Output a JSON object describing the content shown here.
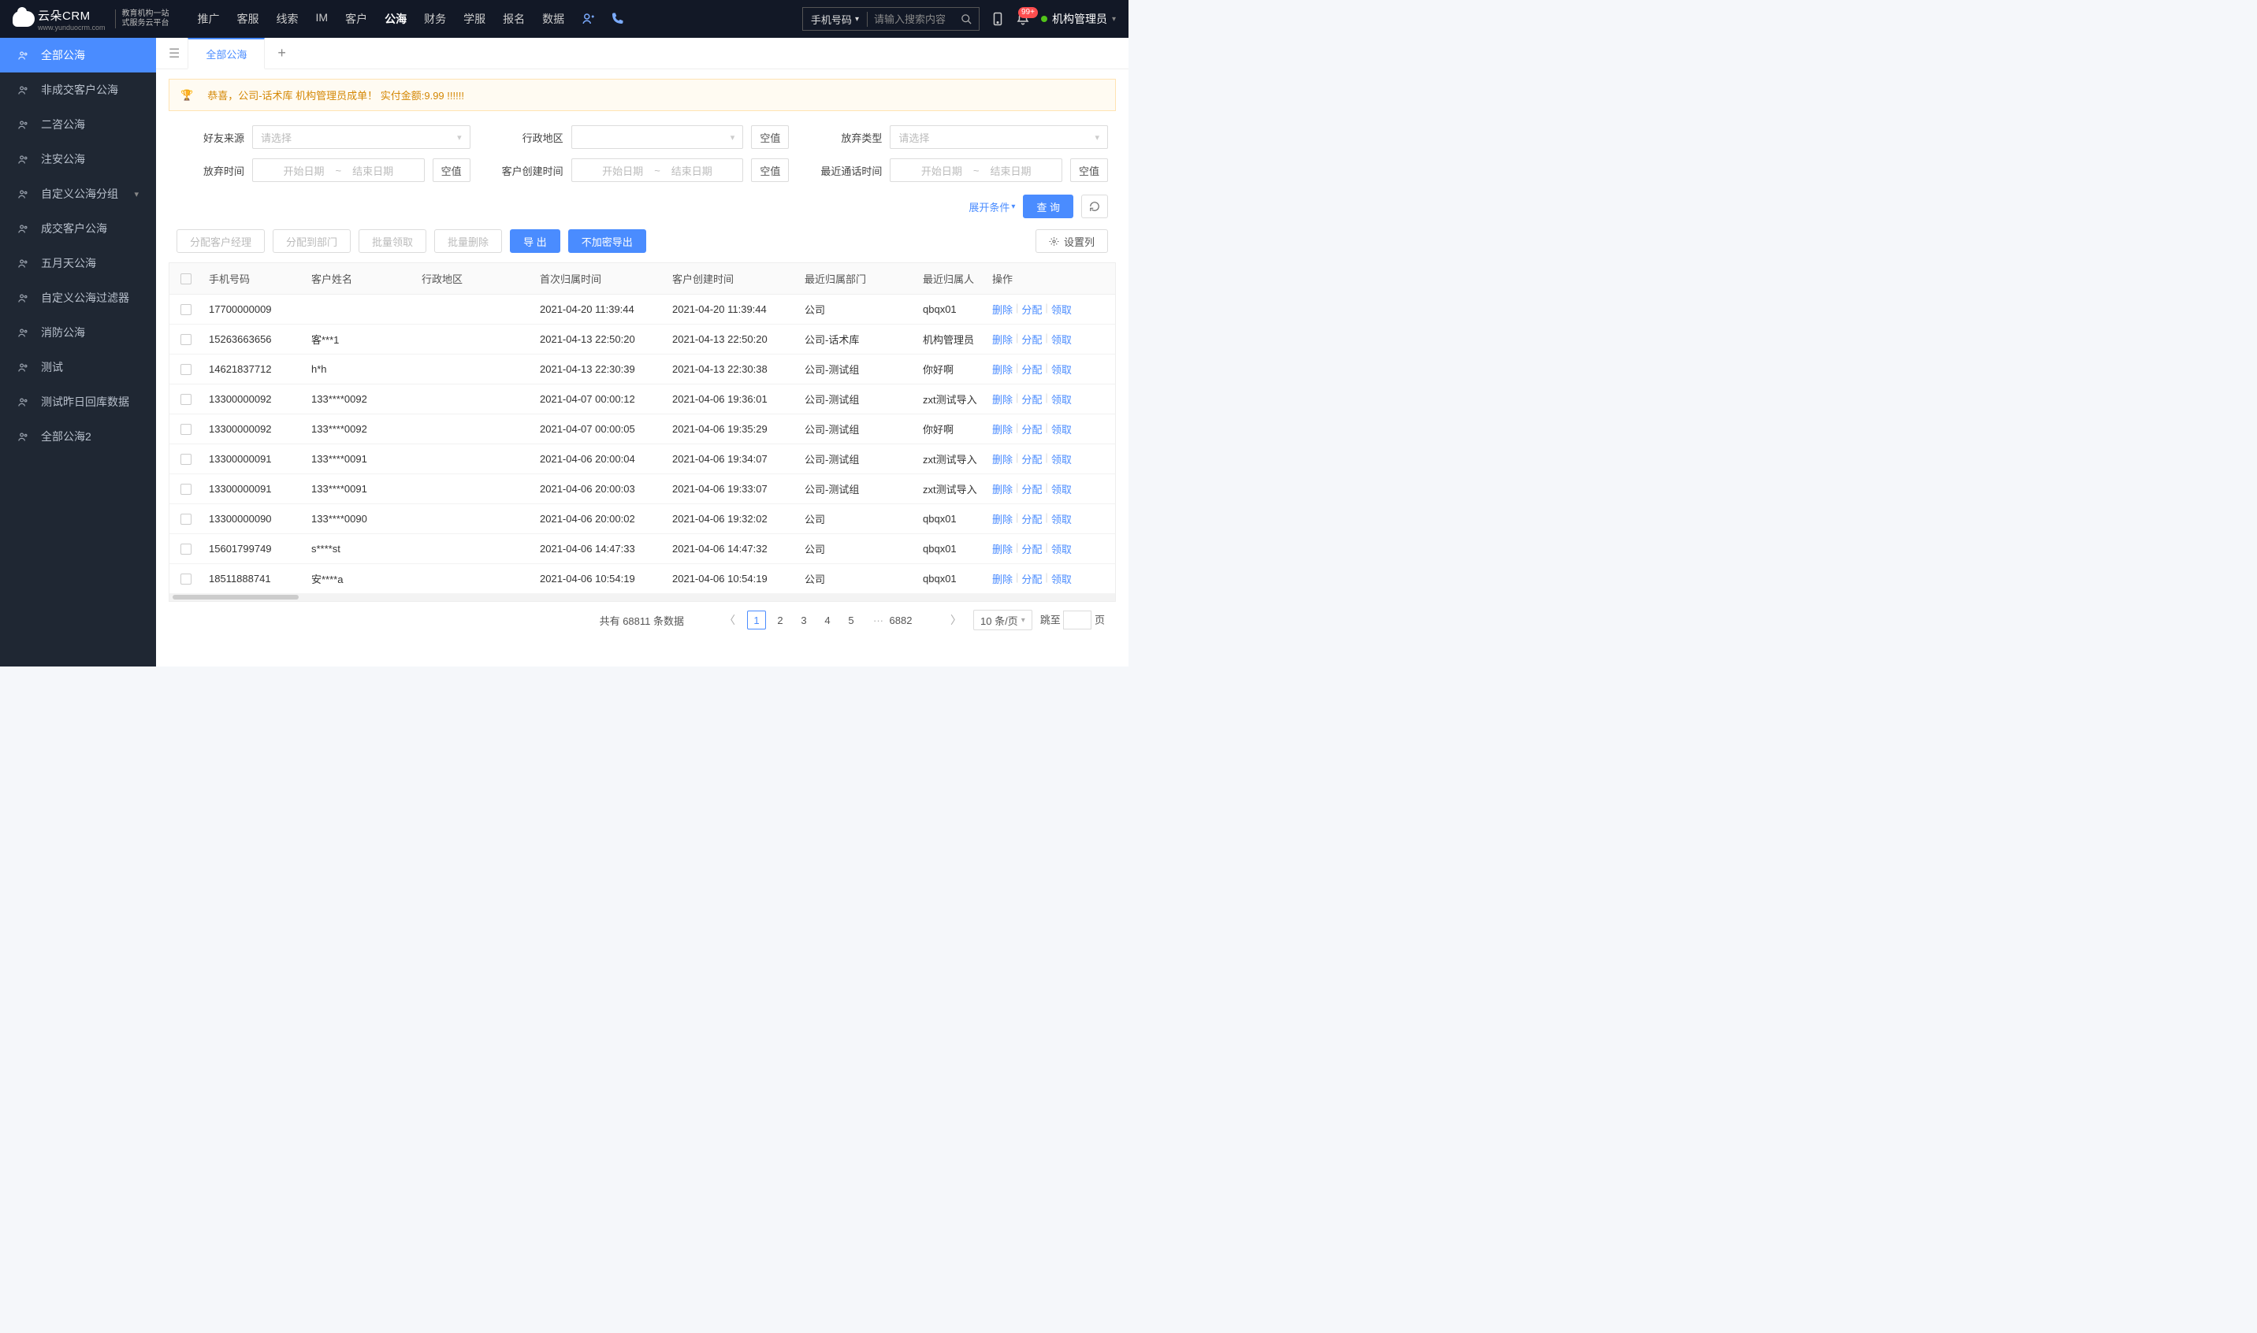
{
  "brand": {
    "name": "云朵CRM",
    "sub1": "教育机构一站",
    "sub2": "式服务云平台",
    "site": "www.yunduocrm.com"
  },
  "top_nav": {
    "items": [
      "推广",
      "客服",
      "线索",
      "IM",
      "客户",
      "公海",
      "财务",
      "学服",
      "报名",
      "数据"
    ],
    "active_index": 5
  },
  "top_search": {
    "type_label": "手机号码",
    "placeholder": "请输入搜索内容"
  },
  "notif_badge": "99+",
  "user_name": "机构管理员",
  "sidebar": {
    "items": [
      {
        "label": "全部公海",
        "active": true
      },
      {
        "label": "非成交客户公海"
      },
      {
        "label": "二咨公海"
      },
      {
        "label": "注安公海"
      },
      {
        "label": "自定义公海分组",
        "chevron": true
      },
      {
        "label": "成交客户公海"
      },
      {
        "label": "五月天公海"
      },
      {
        "label": "自定义公海过滤器"
      },
      {
        "label": "消防公海"
      },
      {
        "label": "测试"
      },
      {
        "label": "测试昨日回库数据"
      },
      {
        "label": "全部公海2"
      }
    ]
  },
  "tabs": {
    "active": "全部公海"
  },
  "banner": "恭喜，公司-话术库  机构管理员成单！  实付金额:9.99 !!!!!!",
  "filters": {
    "source": {
      "label": "好友来源",
      "placeholder": "请选择"
    },
    "area": {
      "label": "行政地区",
      "empty": "空值"
    },
    "abandon_type": {
      "label": "放弃类型",
      "placeholder": "请选择"
    },
    "abandon_time": {
      "label": "放弃时间",
      "start": "开始日期",
      "end": "结束日期",
      "empty": "空值"
    },
    "create_time": {
      "label": "客户创建时间",
      "start": "开始日期",
      "end": "结束日期",
      "empty": "空值"
    },
    "call_time": {
      "label": "最近通话时间",
      "start": "开始日期",
      "end": "结束日期",
      "empty": "空值"
    }
  },
  "actions": {
    "expand": "展开条件",
    "query": "查 询"
  },
  "toolbar": {
    "assign_mgr": "分配客户经理",
    "assign_dept": "分配到部门",
    "batch_claim": "批量领取",
    "batch_del": "批量删除",
    "export": "导 出",
    "export_plain": "不加密导出",
    "set_cols": "设置列"
  },
  "table": {
    "cols": [
      "手机号码",
      "客户姓名",
      "行政地区",
      "首次归属时间",
      "客户创建时间",
      "最近归属部门",
      "最近归属人",
      "操作"
    ],
    "ops": {
      "del": "删除",
      "assign": "分配",
      "claim": "领取"
    },
    "rows": [
      {
        "phone": "17700000009",
        "name": "",
        "area": "",
        "first": "2021-04-20 11:39:44",
        "created": "2021-04-20 11:39:44",
        "dept": "公司",
        "owner": "qbqx01"
      },
      {
        "phone": "15263663656",
        "name": "客***1",
        "area": "",
        "first": "2021-04-13 22:50:20",
        "created": "2021-04-13 22:50:20",
        "dept": "公司-话术库",
        "owner": "机构管理员"
      },
      {
        "phone": "14621837712",
        "name": "h*h",
        "area": "",
        "first": "2021-04-13 22:30:39",
        "created": "2021-04-13 22:30:38",
        "dept": "公司-测试组",
        "owner": "你好啊"
      },
      {
        "phone": "13300000092",
        "name": "133****0092",
        "area": "",
        "first": "2021-04-07 00:00:12",
        "created": "2021-04-06 19:36:01",
        "dept": "公司-测试组",
        "owner": "zxt测试导入"
      },
      {
        "phone": "13300000092",
        "name": "133****0092",
        "area": "",
        "first": "2021-04-07 00:00:05",
        "created": "2021-04-06 19:35:29",
        "dept": "公司-测试组",
        "owner": "你好啊"
      },
      {
        "phone": "13300000091",
        "name": "133****0091",
        "area": "",
        "first": "2021-04-06 20:00:04",
        "created": "2021-04-06 19:34:07",
        "dept": "公司-测试组",
        "owner": "zxt测试导入"
      },
      {
        "phone": "13300000091",
        "name": "133****0091",
        "area": "",
        "first": "2021-04-06 20:00:03",
        "created": "2021-04-06 19:33:07",
        "dept": "公司-测试组",
        "owner": "zxt测试导入"
      },
      {
        "phone": "13300000090",
        "name": "133****0090",
        "area": "",
        "first": "2021-04-06 20:00:02",
        "created": "2021-04-06 19:32:02",
        "dept": "公司",
        "owner": "qbqx01"
      },
      {
        "phone": "15601799749",
        "name": "s****st",
        "area": "",
        "first": "2021-04-06 14:47:33",
        "created": "2021-04-06 14:47:32",
        "dept": "公司",
        "owner": "qbqx01"
      },
      {
        "phone": "18511888741",
        "name": "安****a",
        "area": "",
        "first": "2021-04-06 10:54:19",
        "created": "2021-04-06 10:54:19",
        "dept": "公司",
        "owner": "qbqx01"
      }
    ]
  },
  "pager": {
    "total_text_pre": "共有 ",
    "total": "68811",
    "total_text_post": " 条数据",
    "pages": [
      "1",
      "2",
      "3",
      "4",
      "5"
    ],
    "last": "6882",
    "size": "10 条/页",
    "jump_pre": "跳至",
    "jump_post": "页"
  }
}
